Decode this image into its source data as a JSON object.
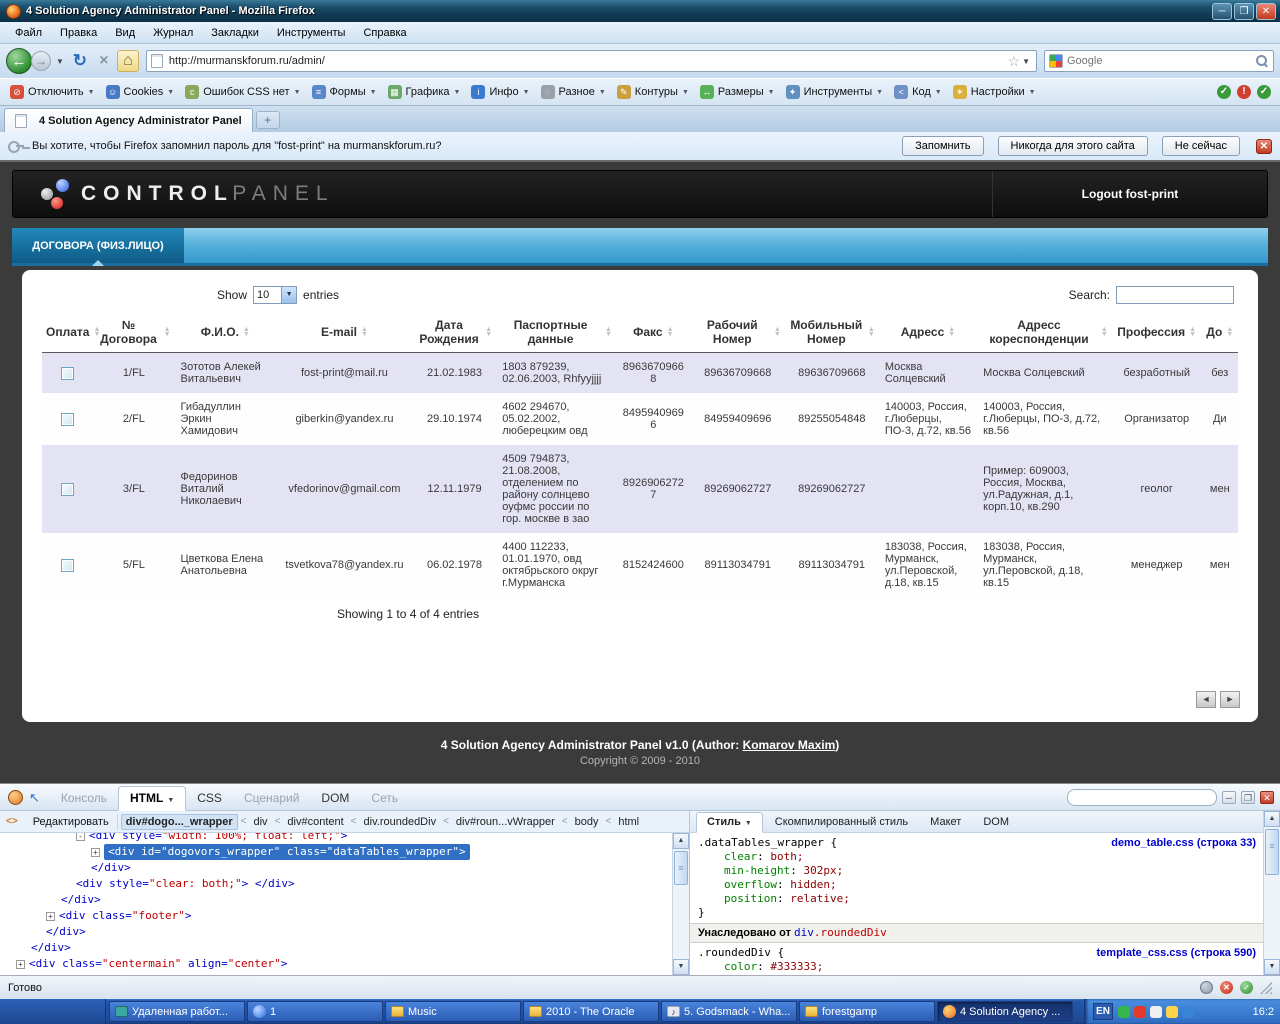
{
  "window": {
    "title": "4 Solution Agency Administrator Panel - Mozilla Firefox"
  },
  "menubar": {
    "items": [
      "Файл",
      "Правка",
      "Вид",
      "Журнал",
      "Закладки",
      "Инструменты",
      "Справка"
    ]
  },
  "navbar": {
    "url": "http://murmanskforum.ru/admin/",
    "search_placeholder": "Google"
  },
  "devbar": {
    "items": [
      {
        "label": "Отключить",
        "glyph": "⊘",
        "color": "#d8503c"
      },
      {
        "label": "Cookies",
        "glyph": "☺",
        "color": "#4a79c8"
      },
      {
        "label": "Ошибок CSS нет",
        "glyph": "c",
        "color": "#8aa85a"
      },
      {
        "label": "Формы",
        "glyph": "≡",
        "color": "#5a87c8"
      },
      {
        "label": "Графика",
        "glyph": "▦",
        "color": "#6aa86a"
      },
      {
        "label": "Инфо",
        "glyph": "i",
        "color": "#3a7ad0"
      },
      {
        "label": "Разное",
        "glyph": "◌",
        "color": "#9aa0a8"
      },
      {
        "label": "Контуры",
        "glyph": "✎",
        "color": "#c8a040"
      },
      {
        "label": "Размеры",
        "glyph": "↔",
        "color": "#58b058"
      },
      {
        "label": "Инструменты",
        "glyph": "✦",
        "color": "#6090c0"
      },
      {
        "label": "Код",
        "glyph": "<",
        "color": "#7090c8"
      },
      {
        "label": "Настройки",
        "glyph": "✶",
        "color": "#d8b040"
      }
    ],
    "status": [
      {
        "name": "css-valid-icon",
        "glyph": "✓",
        "color": "#3a9a3a"
      },
      {
        "name": "js-error-icon",
        "glyph": "!",
        "color": "#d04030"
      },
      {
        "name": "render-ok-icon",
        "glyph": "✓",
        "color": "#3a9a3a"
      }
    ]
  },
  "tabbar": {
    "tab_title": "4 Solution Agency Administrator Panel",
    "new_tab": "+"
  },
  "notification": {
    "message": "Вы хотите, чтобы Firefox запомнил пароль для \"fost-print\" на murmanskforum.ru?",
    "remember": "Запомнить",
    "never": "Никогда для этого сайта",
    "not_now": "Не сейчас",
    "close": "x"
  },
  "panel": {
    "brand_bold": "CONTROL",
    "brand_light": "PANEL",
    "logout": "Logout fost-print",
    "tab": "ДОГОВОРА (ФИЗ.ЛИЦО)"
  },
  "table": {
    "length_before": "Show",
    "length_value": "10",
    "length_after": "entries",
    "search_label": "Search:",
    "headers": [
      "Оплата",
      "№ Договора",
      "Ф.И.О.",
      "E-mail",
      "Дата Рождения",
      "Паспортные данные",
      "Факс",
      "Рабочий Номер",
      "Мобильный Номер",
      "Адресс",
      "Адресс кореспонденции",
      "Профессия",
      "До"
    ],
    "rows": [
      [
        "1/FL",
        "Зототов Алекей Витальевич",
        "fost-print@mail.ru",
        "21.02.1983",
        "1803 879239, 02.06.2003, Rhfyyjjjj",
        "89636709668",
        "89636709668",
        "89636709668",
        "Москва Солцевский",
        "Москва Солцевский",
        "безработный",
        "без"
      ],
      [
        "2/FL",
        "Гибадуллин Эркин Хамидович",
        "giberkin@yandex.ru",
        "29.10.1974",
        "4602 294670, 05.02.2002, люберецким овд",
        "84959409696",
        "84959409696",
        "89255054848",
        "140003, Россия, г.Люберцы, ПО-3, д.72, кв.56",
        "140003, Россия, г.Люберцы, ПО-3, д.72, кв.56",
        "Организатор",
        "Ди"
      ],
      [
        "3/FL",
        "Федоринов Виталий Николаевич",
        "vfedorinov@gmail.com",
        "12.11.1979",
        "4509 794873, 21.08.2008, отделением по району солнцево оуфмс россии по гор. москве в зао",
        "89269062727",
        "89269062727",
        "89269062727",
        "",
        "Пример: 609003, Россия, Москва, ул.Радужная, д.1, корп.10, кв.290",
        "геолог",
        "мен"
      ],
      [
        "5/FL",
        "Цветкова Елена Анатольевна",
        "tsvetkova78@yandex.ru",
        "06.02.1978",
        "4400 112233, 01.01.1970, овд октябрьского округ г.Мурманска",
        "8152424600",
        "89113034791",
        "89113034791",
        "183038, Россия, Мурманск, ул.Перовской, д.18, кв.15",
        "183038, Россия, Мурманск, ул.Перовской, д.18, кв.15",
        "менеджер",
        "мен"
      ]
    ],
    "info": "Showing 1 to 4 of 4 entries",
    "prev": "◄",
    "next": "►"
  },
  "site_footer": {
    "credit_prefix": "4 Solution Agency Administrator Panel v1.0 (Author: ",
    "credit_link": "Komarov Maxim",
    "credit_suffix": ")",
    "copyright": "Copyright © 2009 - 2010"
  },
  "firebug": {
    "tabs": [
      {
        "label": "Консоль",
        "state": "disabled"
      },
      {
        "label": "HTML",
        "state": "active",
        "caret": true
      },
      {
        "label": "CSS",
        "state": "normal"
      },
      {
        "label": "Сценарий",
        "state": "disabled"
      },
      {
        "label": "DOM",
        "state": "normal"
      },
      {
        "label": "Сеть",
        "state": "disabled"
      }
    ],
    "edit_button": "Редактировать",
    "breadcrumb": [
      {
        "label": "div#dogo..._wrapper",
        "selected": true
      },
      {
        "label": "div"
      },
      {
        "label": "div#content"
      },
      {
        "label": "div.roundedDiv"
      },
      {
        "label": "div#roun...vWrapper"
      },
      {
        "label": "body"
      },
      {
        "label": "html"
      }
    ],
    "html_lines": [
      {
        "indent": 4,
        "exp": "-",
        "segs": [
          [
            "tag",
            "<div "
          ],
          [
            "attr",
            "style="
          ],
          [
            "val",
            "\"width: 100%; float: left;\""
          ],
          [
            "tag",
            ">"
          ]
        ]
      },
      {
        "indent": 5,
        "exp": "+",
        "sel": true,
        "segs": [
          [
            "tag",
            "<div "
          ],
          [
            "attr",
            "id="
          ],
          [
            "val",
            "\"dogovors_wrapper\""
          ],
          [
            "attr",
            " class="
          ],
          [
            "val",
            "\"dataTables_wrapper\""
          ],
          [
            "tag",
            ">"
          ]
        ]
      },
      {
        "indent": 5,
        "segs": [
          [
            "tag",
            "</div>"
          ]
        ]
      },
      {
        "indent": 4,
        "segs": [
          [
            "tag",
            "<div "
          ],
          [
            "attr",
            "style="
          ],
          [
            "val",
            "\"clear: both;\""
          ],
          [
            "tag",
            "> </div>"
          ]
        ]
      },
      {
        "indent": 3,
        "segs": [
          [
            "tag",
            "</div>"
          ]
        ]
      },
      {
        "indent": 2,
        "exp": "+",
        "segs": [
          [
            "tag",
            "<div "
          ],
          [
            "attr",
            "class="
          ],
          [
            "val",
            "\"footer\""
          ],
          [
            "tag",
            ">"
          ]
        ]
      },
      {
        "indent": 2,
        "segs": [
          [
            "tag",
            "</div>"
          ]
        ]
      },
      {
        "indent": 1,
        "segs": [
          [
            "tag",
            "</div>"
          ]
        ]
      },
      {
        "indent": 0,
        "exp": "+",
        "segs": [
          [
            "tag",
            "<div "
          ],
          [
            "attr",
            "class="
          ],
          [
            "val",
            "\"centermain\""
          ],
          [
            "attr",
            " align="
          ],
          [
            "val",
            "\"center\""
          ],
          [
            "tag",
            ">"
          ]
        ]
      }
    ],
    "style_tabs": [
      {
        "label": "Стиль",
        "state": "active",
        "caret": true
      },
      {
        "label": "Скомпилированный стиль"
      },
      {
        "label": "Макет"
      },
      {
        "label": "DOM"
      }
    ],
    "rule1": {
      "file": "demo_table.css (строка 33)",
      "selector": ".dataTables_wrapper {",
      "props": [
        [
          "clear",
          "both"
        ],
        [
          "min-height",
          "302px"
        ],
        [
          "overflow",
          "hidden"
        ],
        [
          "position",
          "relative"
        ]
      ],
      "close": "}"
    },
    "inherited": {
      "label": "Унаследовано от ",
      "tag": "div",
      "cls": ".roundedDiv"
    },
    "rule2": {
      "file": "template_css.css (строка 590)",
      "selector": ".roundedDiv {",
      "props": [
        [
          "color",
          "#333333"
        ]
      ]
    }
  },
  "statusbar": {
    "status": "Готово"
  },
  "taskbar": {
    "buttons": [
      {
        "label": "Удаленная работ...",
        "icon": "remote"
      },
      {
        "label": "1",
        "icon": "chat"
      },
      {
        "label": "Music",
        "icon": "folder"
      },
      {
        "label": "2010 - The Oracle",
        "icon": "folder"
      },
      {
        "label": "5. Godsmack - Wha...",
        "icon": "media"
      },
      {
        "label": "forestgamp",
        "icon": "folder"
      },
      {
        "label": "4 Solution Agency ...",
        "icon": "firefox",
        "active": true
      }
    ],
    "tray": {
      "lang": "EN",
      "icons": [
        "#35b54a",
        "#e23b2e",
        "#f0f0f0",
        "#ffd24a",
        "#3a84d8"
      ],
      "time": "16:2"
    }
  }
}
